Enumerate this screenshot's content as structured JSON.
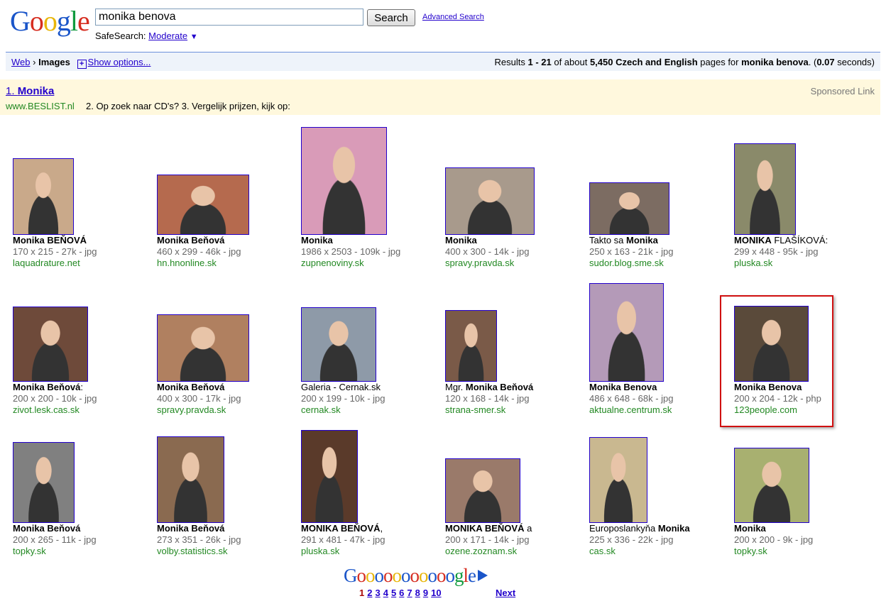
{
  "header": {
    "logo": "Google",
    "search_value": "monika benova",
    "search_button": "Search",
    "advanced_search": "Advanced Search",
    "safesearch_label": "SafeSearch:",
    "safesearch_value": "Moderate"
  },
  "topbar": {
    "web": "Web",
    "sep": "›",
    "images": "Images",
    "show_options": "Show options...",
    "results_pre": "Results ",
    "results_range": "1 - 21",
    "results_mid": " of about ",
    "results_count": "5,450 Czech and English",
    "results_mid2": " pages for ",
    "results_query": "monika benova",
    "results_time_pre": ". (",
    "results_time": "0.07",
    "results_time_post": " seconds)"
  },
  "ad": {
    "num": "1.",
    "title": "Monika",
    "url": "www.BESLIST.nl",
    "desc": "2. Op zoek naar CD's? 3. Vergelijk prijzen, kijk op:",
    "sponsored": "Sponsored Link"
  },
  "results": [
    {
      "title_plain": "",
      "title_bold": "Monika BEŇOVÁ",
      "title_after": "",
      "meta": "170 x 215 - 27k - jpg",
      "domain": "laquadrature.net",
      "bg": "#c9a98a"
    },
    {
      "title_plain": "",
      "title_bold": "Monika Beňová",
      "title_after": "",
      "meta": "460 x 299 - 46k - jpg",
      "domain": "hn.hnonline.sk",
      "bg": "#b56a4e"
    },
    {
      "title_plain": "",
      "title_bold": "Monika",
      "title_after": "",
      "meta": "1986 x 2503 - 109k - jpg",
      "domain": "zupnenoviny.sk",
      "bg": "#d99bb8"
    },
    {
      "title_plain": "",
      "title_bold": "Monika",
      "title_after": "",
      "meta": "400 x 300 - 14k - jpg",
      "domain": "spravy.pravda.sk",
      "bg": "#a89a8c"
    },
    {
      "title_plain": "Takto sa ",
      "title_bold": "Monika",
      "title_after": "",
      "meta": "250 x 163 - 21k - jpg",
      "domain": "sudor.blog.sme.sk",
      "bg": "#7c6c62"
    },
    {
      "title_plain": "",
      "title_bold": "MONIKA",
      "title_after": " FLAŠÍKOVÁ:",
      "meta": "299 x 448 - 95k - jpg",
      "domain": "pluska.sk",
      "bg": "#8a8a6a"
    },
    {
      "title_plain": "",
      "title_bold": "Monika Beňová",
      "title_after": ":",
      "meta": "200 x 200 - 10k - jpg",
      "domain": "zivot.lesk.cas.sk",
      "bg": "#6e4a3a"
    },
    {
      "title_plain": "",
      "title_bold": "Monika Beňová",
      "title_after": "",
      "meta": "400 x 300 - 17k - jpg",
      "domain": "spravy.pravda.sk",
      "bg": "#b08060"
    },
    {
      "title_plain": "Galeria - Cernak.sk",
      "title_bold": "",
      "title_after": "",
      "meta": "200 x 199 - 10k - jpg",
      "domain": "cernak.sk",
      "bg": "#8e9aa8"
    },
    {
      "title_plain": "Mgr. ",
      "title_bold": "Monika Beňová",
      "title_after": "",
      "meta": "120 x 168 - 14k - jpg",
      "domain": "strana-smer.sk",
      "bg": "#7a5a48"
    },
    {
      "title_plain": "",
      "title_bold": "Monika Benova",
      "title_after": "",
      "meta": "486 x 648 - 68k - jpg",
      "domain": "aktualne.centrum.sk",
      "bg": "#b49ab8"
    },
    {
      "title_plain": "",
      "title_bold": "Monika Benova",
      "title_after": "",
      "meta": "200 x 204 - 12k - php",
      "domain": "123people.com",
      "bg": "#5a4a3a"
    },
    {
      "title_plain": "",
      "title_bold": "Monika Beňová",
      "title_after": "",
      "meta": "200 x 265 - 11k - jpg",
      "domain": "topky.sk",
      "bg": "#808080"
    },
    {
      "title_plain": "",
      "title_bold": "Monika Beňová",
      "title_after": "",
      "meta": "273 x 351 - 26k - jpg",
      "domain": "volby.statistics.sk",
      "bg": "#8a6a50"
    },
    {
      "title_plain": "",
      "title_bold": "MONIKA BEŇOVÁ",
      "title_after": ",",
      "meta": "291 x 481 - 47k - jpg",
      "domain": "pluska.sk",
      "bg": "#5a3a2a"
    },
    {
      "title_plain": "",
      "title_bold": "MONIKA BEŇOVÁ",
      "title_after": " a",
      "meta": "200 x 171 - 14k - jpg",
      "domain": "ozene.zoznam.sk",
      "bg": "#9a7a6a"
    },
    {
      "title_plain": "Europoslankyňa ",
      "title_bold": "Monika",
      "title_after": "",
      "meta": "225 x 336 - 22k - jpg",
      "domain": "cas.sk",
      "bg": "#c9b890"
    },
    {
      "title_plain": "",
      "title_bold": "Monika",
      "title_after": "",
      "meta": "200 x 200 - 9k - jpg",
      "domain": "topky.sk",
      "bg": "#a8b070"
    }
  ],
  "pager": {
    "logo": "Gooooooooooogle",
    "current": "1",
    "pages": [
      "2",
      "3",
      "4",
      "5",
      "6",
      "7",
      "8",
      "9",
      "10"
    ],
    "next": "Next"
  },
  "colors": {
    "link": "#2200cc",
    "domain": "#228822",
    "meta": "#666666",
    "highlight": "#d01010",
    "ad_bg": "#fff8dd",
    "topbar_bg": "#eef3fa"
  }
}
